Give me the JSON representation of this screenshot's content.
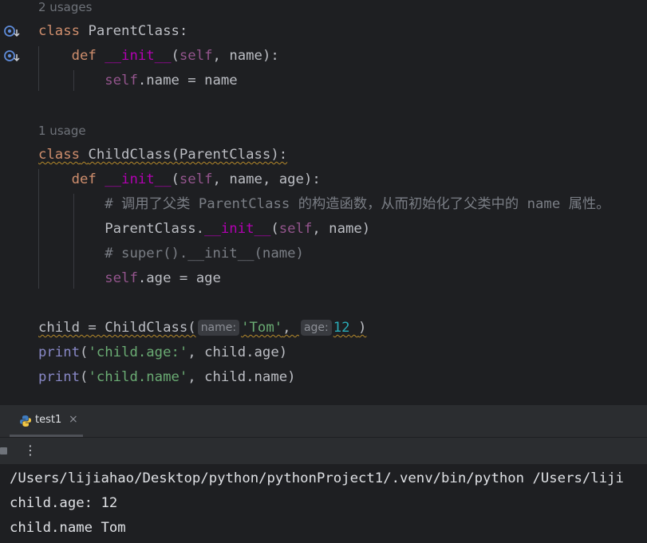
{
  "editor": {
    "usage_hint_1": "2 usages",
    "usage_hint_2": "1 usage",
    "code": {
      "l1_kw": "class",
      "l1_name": "ParentClass",
      "l1_colon": ":",
      "l2_def": "def",
      "l2_fn": "__init__",
      "l2_open": "(",
      "l2_self": "self",
      "l2_rest": ", name):",
      "l3_self": "self",
      "l3_rest": ".name = name",
      "l4_kw": "class",
      "l4_rest": "ChildClass(ParentClass):",
      "l5_def": "def",
      "l5_fn": "__init__",
      "l5_open": "(",
      "l5_self": "self",
      "l5_rest": ", name, age):",
      "l6_comment": "# 调用了父类 ParentClass 的构造函数，从而初始化了父类中的 name 属性。",
      "l7_cls": "ParentClass.",
      "l7_fn": "__init__",
      "l7_open": "(",
      "l7_self": "self",
      "l7_rest": ", name)",
      "l8_comment": "# super().__init__(name)",
      "l9_self": "self",
      "l9_rest": ".age = age",
      "l10_prefix": "child = ChildClass(",
      "l10_hint_name": "name:",
      "l10_str": "'Tom'",
      "l10_comma": ", ",
      "l10_hint_age": "age:",
      "l10_num": "12",
      "l10_close": ")",
      "l11_print": "print",
      "l11_open": "(",
      "l11_str": "'child.age:'",
      "l11_rest": ", child.age)",
      "l12_print": "print",
      "l12_open": "(",
      "l12_str": "'child.name'",
      "l12_rest": ", child.name)"
    }
  },
  "run_panel": {
    "tab_label": "test1",
    "tab_close": "×",
    "more_menu": "⋮"
  },
  "console": {
    "lines": [
      "/Users/lijiahao/Desktop/python/pythonProject1/.venv/bin/python /Users/liji",
      "child.age: 12",
      "child.name Tom"
    ]
  },
  "icons": {
    "gutter": "override-arrow-icon",
    "python": "python-file-icon"
  }
}
